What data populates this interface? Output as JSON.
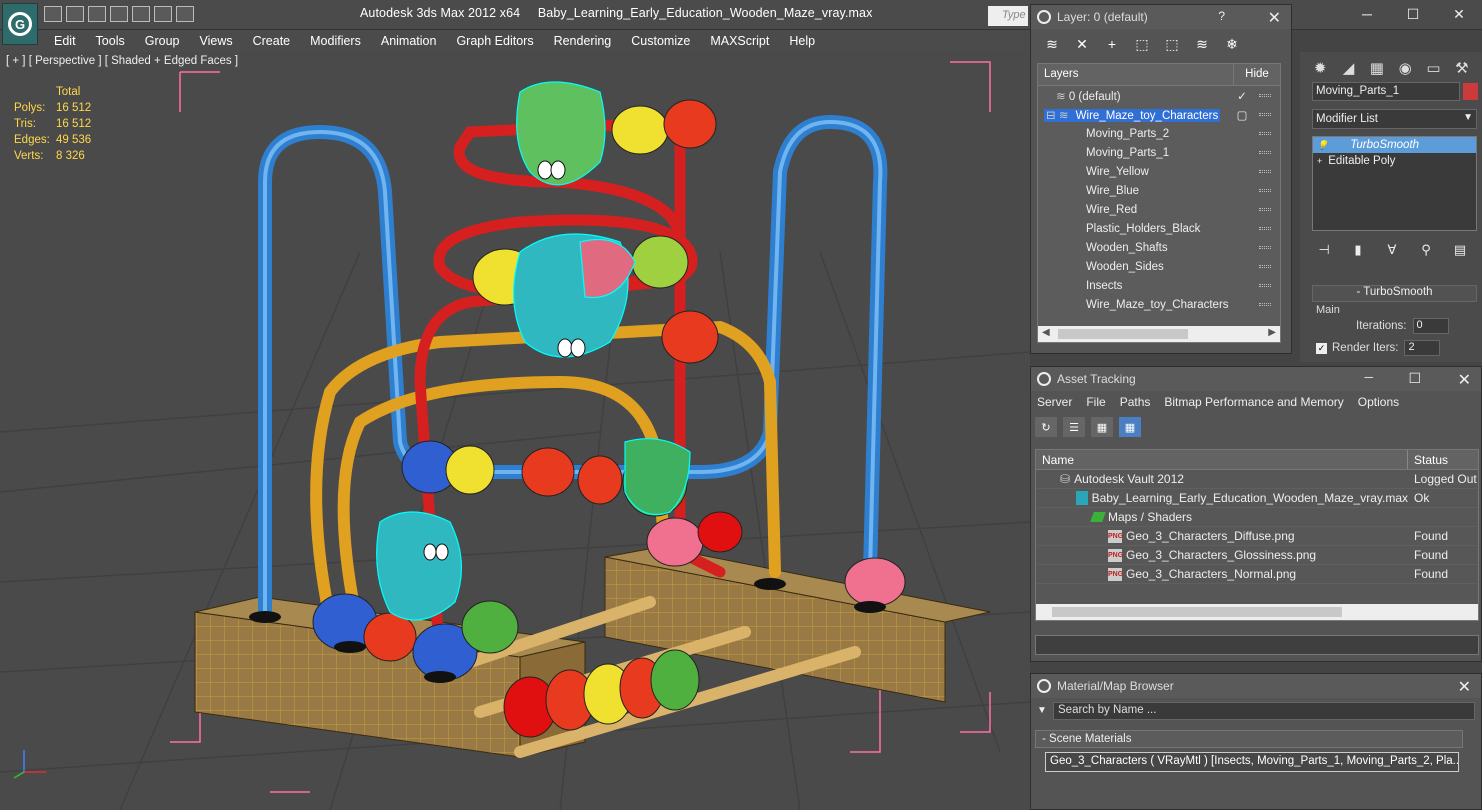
{
  "app": {
    "title": "Autodesk 3ds Max  2012 x64",
    "file": "Baby_Learning_Early_Education_Wooden_Maze_vray.max",
    "search_placeholder": "Type"
  },
  "menu": [
    "Edit",
    "Tools",
    "Group",
    "Views",
    "Create",
    "Modifiers",
    "Animation",
    "Graph Editors",
    "Rendering",
    "Customize",
    "MAXScript",
    "Help"
  ],
  "viewport": {
    "label": "[ + ] [ Perspective ] [ Shaded + Edged Faces ]",
    "stats_header": "Total",
    "stats": [
      {
        "k": "Polys:",
        "v": "16 512"
      },
      {
        "k": "Tris:",
        "v": "16 512"
      },
      {
        "k": "Edges:",
        "v": "49 536"
      },
      {
        "k": "Verts:",
        "v": "8 326"
      }
    ]
  },
  "layers_panel": {
    "title": "Layer: 0 (default)",
    "col_layers": "Layers",
    "col_hide": "Hide",
    "rows": [
      {
        "name": "0 (default)",
        "indent": 0,
        "selected": false
      },
      {
        "name": "Wire_Maze_toy_Characters",
        "indent": 1,
        "selected": true
      },
      {
        "name": "Moving_Parts_2",
        "indent": 2,
        "selected": false
      },
      {
        "name": "Moving_Parts_1",
        "indent": 2,
        "selected": false
      },
      {
        "name": "Wire_Yellow",
        "indent": 2,
        "selected": false
      },
      {
        "name": "Wire_Blue",
        "indent": 2,
        "selected": false
      },
      {
        "name": "Wire_Red",
        "indent": 2,
        "selected": false
      },
      {
        "name": "Plastic_Holders_Black",
        "indent": 2,
        "selected": false
      },
      {
        "name": "Wooden_Shafts",
        "indent": 2,
        "selected": false
      },
      {
        "name": "Wooden_Sides",
        "indent": 2,
        "selected": false
      },
      {
        "name": "Insects",
        "indent": 2,
        "selected": false
      },
      {
        "name": "Wire_Maze_toy_Characters",
        "indent": 2,
        "selected": false
      }
    ]
  },
  "command_panel": {
    "object_name": "Moving_Parts_1",
    "object_color": "#cc3b3b",
    "modifier_list": "Modifier List",
    "stack": [
      {
        "name": "TurboSmooth",
        "selected": true
      },
      {
        "name": "Editable Poly",
        "selected": false
      }
    ],
    "rollout_title": "TurboSmooth",
    "main_label": "Main",
    "iterations_label": "Iterations:",
    "iterations_value": "0",
    "render_iters_label": "Render Iters:",
    "render_iters_value": "2"
  },
  "asset_tracking": {
    "title": "Asset Tracking",
    "menu": [
      "Server",
      "File",
      "Paths",
      "Bitmap Performance and Memory",
      "Options"
    ],
    "col_name": "Name",
    "col_status": "Status",
    "rows": [
      {
        "name": "Autodesk Vault 2012",
        "status": "Logged Out",
        "indent": 1,
        "icon": "vault"
      },
      {
        "name": "Baby_Learning_Early_Education_Wooden_Maze_vray.max",
        "status": "Ok",
        "indent": 2,
        "icon": "max"
      },
      {
        "name": "Maps / Shaders",
        "status": "",
        "indent": 3,
        "icon": "maps"
      },
      {
        "name": "Geo_3_Characters_Diffuse.png",
        "status": "Found",
        "indent": 4,
        "icon": "png"
      },
      {
        "name": "Geo_3_Characters_Glossiness.png",
        "status": "Found",
        "indent": 4,
        "icon": "png"
      },
      {
        "name": "Geo_3_Characters_Normal.png",
        "status": "Found",
        "indent": 4,
        "icon": "png"
      }
    ]
  },
  "material_browser": {
    "title": "Material/Map Browser",
    "search_placeholder": "Search by Name ...",
    "section": "- Scene Materials",
    "item": "Geo_3_Characters  ( VRayMtl ) [Insects, Moving_Parts_1, Moving_Parts_2, Pla..."
  }
}
